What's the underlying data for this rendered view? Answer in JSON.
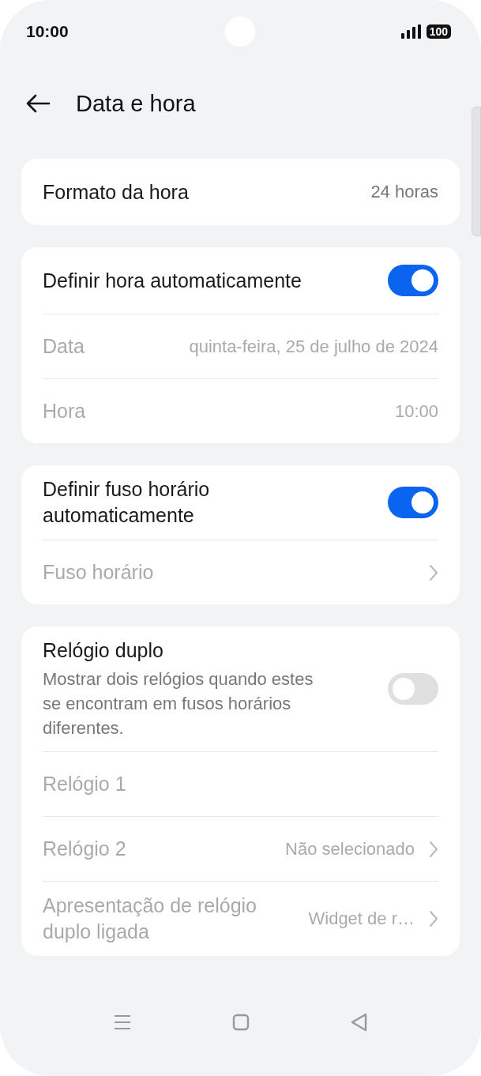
{
  "status_bar": {
    "time": "10:00",
    "battery": "100"
  },
  "title": "Data e hora",
  "cards": [
    {
      "rows": [
        {
          "kind": "value",
          "label": "Formato da hora",
          "value": "24 horas",
          "disabled": false,
          "chevron": false
        }
      ]
    },
    {
      "rows": [
        {
          "kind": "toggle",
          "label": "Definir hora automaticamente",
          "on": true
        },
        {
          "kind": "value",
          "label": "Data",
          "value": "quinta-feira, 25 de julho de 2024",
          "disabled": true,
          "chevron": false
        },
        {
          "kind": "value",
          "label": "Hora",
          "value": "10:00",
          "disabled": true,
          "chevron": false
        }
      ]
    },
    {
      "rows": [
        {
          "kind": "toggle",
          "label": "Definir fuso horário automaticamente",
          "on": true
        },
        {
          "kind": "value",
          "label": "Fuso horário",
          "disabled": true,
          "chevron": true
        }
      ]
    },
    {
      "rows": [
        {
          "kind": "toggle",
          "label": "Relógio duplo",
          "description": "Mostrar dois relógios quando estes se encontram em fusos horários diferentes.",
          "on": false
        },
        {
          "kind": "value",
          "label": "Relógio 1",
          "disabled": true,
          "chevron": false
        },
        {
          "kind": "value",
          "label": "Relógio 2",
          "value": "Não selecionado",
          "disabled": true,
          "chevron": true
        },
        {
          "kind": "value",
          "label": "Apresentação de relógio duplo ligada",
          "value": "Widget de r…",
          "disabled": true,
          "chevron": true
        }
      ]
    }
  ]
}
